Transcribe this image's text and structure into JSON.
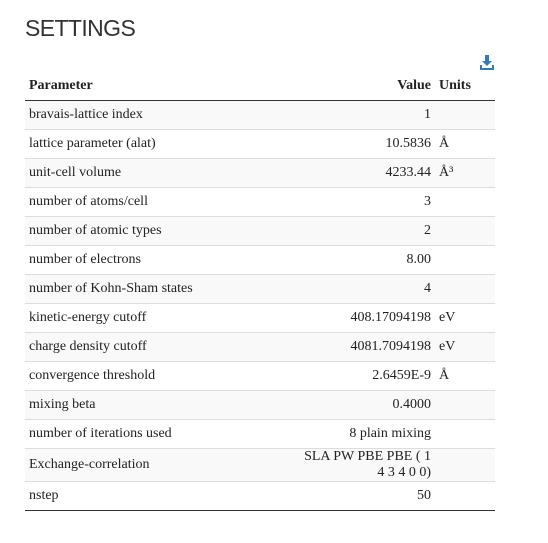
{
  "page": {
    "title": "SETTINGS"
  },
  "download": {
    "icon": "download-icon",
    "color": "#337ab7"
  },
  "table": {
    "headers": {
      "parameter": "Parameter",
      "value": "Value",
      "units": "Units"
    },
    "rows": [
      {
        "parameter": "bravais-lattice index",
        "value": "1",
        "units": ""
      },
      {
        "parameter": "lattice parameter (alat)",
        "value": "10.5836",
        "units": "Å"
      },
      {
        "parameter": "unit-cell volume",
        "value": "4233.44",
        "units": "Å³"
      },
      {
        "parameter": "number of atoms/cell",
        "value": "3",
        "units": ""
      },
      {
        "parameter": "number of atomic types",
        "value": "2",
        "units": ""
      },
      {
        "parameter": "number of electrons",
        "value": "8.00",
        "units": ""
      },
      {
        "parameter": "number of Kohn-Sham states",
        "value": "4",
        "units": ""
      },
      {
        "parameter": "kinetic-energy cutoff",
        "value": "408.17094198",
        "units": "eV"
      },
      {
        "parameter": "charge density cutoff",
        "value": "4081.7094198",
        "units": "eV"
      },
      {
        "parameter": "convergence threshold",
        "value": "2.6459E-9",
        "units": "Å"
      },
      {
        "parameter": "mixing beta",
        "value": "0.4000",
        "units": ""
      },
      {
        "parameter": "number of iterations used",
        "value": "8 plain mixing",
        "units": ""
      },
      {
        "parameter": "Exchange-correlation",
        "value": "SLA PW PBE PBE ( 1 4 3 4 0 0)",
        "units": ""
      },
      {
        "parameter": "nstep",
        "value": "50",
        "units": ""
      }
    ]
  }
}
